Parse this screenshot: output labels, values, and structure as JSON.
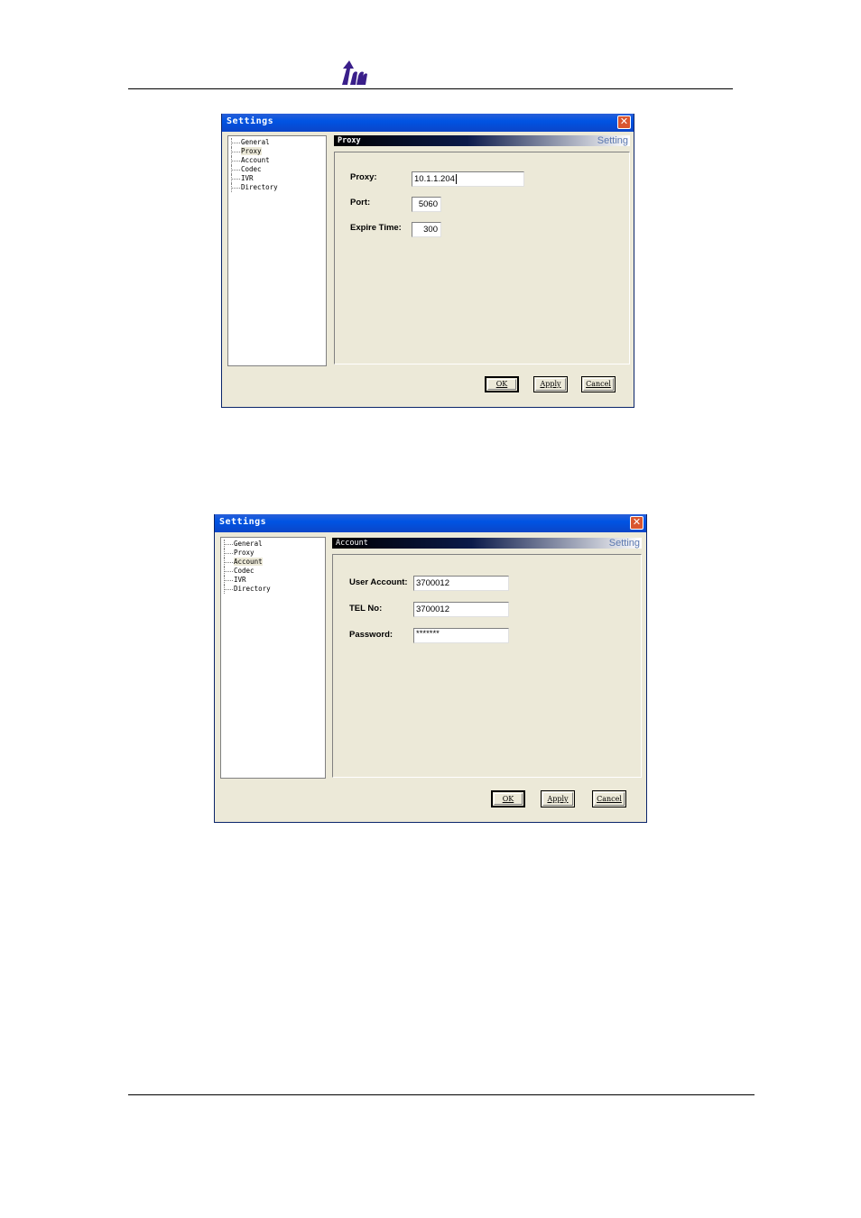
{
  "window1": {
    "title": "Settings",
    "tree": [
      "General",
      "Proxy",
      "Account",
      "Codec",
      "IVR",
      "Directory"
    ],
    "selected_index": 1,
    "panel": {
      "title": "Proxy",
      "subtitle": "Setting"
    },
    "fields": [
      {
        "label": "Proxy:",
        "value": "10.1.1.204"
      },
      {
        "label": "Port:",
        "value": "5060"
      },
      {
        "label": "Expire Time:",
        "value": "300"
      }
    ],
    "buttons": {
      "ok": "OK",
      "apply": "Apply",
      "cancel": "Cancel"
    }
  },
  "window2": {
    "title": "Settings",
    "tree": [
      "General",
      "Proxy",
      "Account",
      "Codec",
      "IVR",
      "Directory"
    ],
    "selected_index": 2,
    "panel": {
      "title": "Account",
      "subtitle": "Setting"
    },
    "fields": [
      {
        "label": "User Account:",
        "value": "3700012"
      },
      {
        "label": "TEL No:",
        "value": "3700012"
      },
      {
        "label": "Password:",
        "value": "*******"
      }
    ],
    "buttons": {
      "ok": "OK",
      "apply": "Apply",
      "cancel": "Cancel"
    }
  },
  "icons": {
    "logo": "company-logo-icon",
    "close": "close-icon"
  },
  "colors": {
    "logo": "#3a1f8a",
    "titlebar": "#0054e3",
    "close": "#d9552f",
    "window_bg": "#ece9d8"
  }
}
